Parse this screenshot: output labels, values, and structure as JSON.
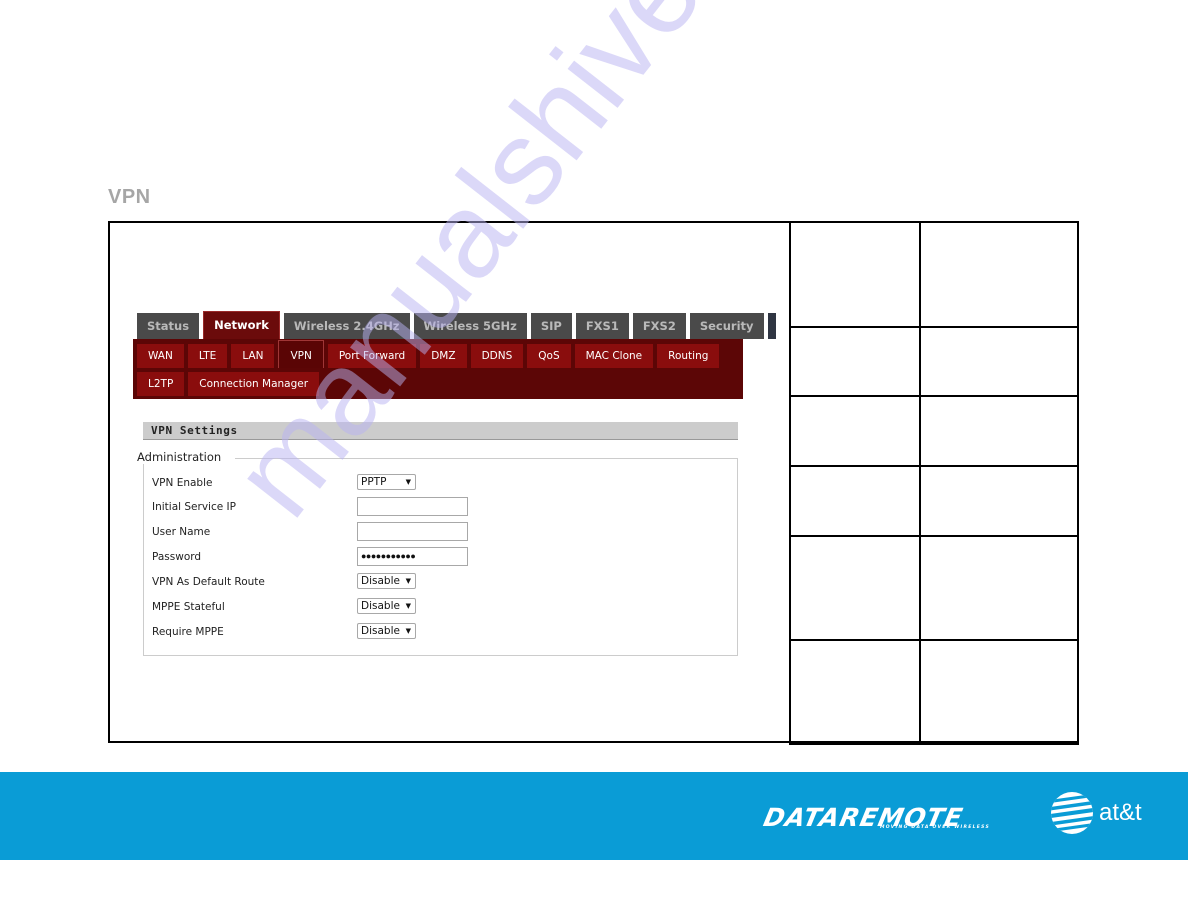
{
  "section_title": "VPN",
  "router_ui": {
    "main_tabs": [
      {
        "label": "Status",
        "active": false
      },
      {
        "label": "Network",
        "active": true
      },
      {
        "label": "Wireless 2.4GHz",
        "active": false
      },
      {
        "label": "Wireless 5GHz",
        "active": false
      },
      {
        "label": "SIP",
        "active": false
      },
      {
        "label": "FXS1",
        "active": false
      },
      {
        "label": "FXS2",
        "active": false
      },
      {
        "label": "Security",
        "active": false
      }
    ],
    "sub_tabs": [
      {
        "label": "WAN",
        "active": false
      },
      {
        "label": "LTE",
        "active": false
      },
      {
        "label": "LAN",
        "active": false
      },
      {
        "label": "VPN",
        "active": true
      },
      {
        "label": "Port Forward",
        "active": false
      },
      {
        "label": "DMZ",
        "active": false
      },
      {
        "label": "DDNS",
        "active": false
      },
      {
        "label": "QoS",
        "active": false
      },
      {
        "label": "MAC Clone",
        "active": false
      },
      {
        "label": "Routing",
        "active": false
      },
      {
        "label": "L2TP",
        "active": false
      },
      {
        "label": "Connection Manager",
        "active": false
      }
    ],
    "panel_title": "VPN Settings",
    "group_legend": "Administration",
    "fields": {
      "vpn_enable": {
        "label": "VPN Enable",
        "value": "PPTP"
      },
      "initial_service_ip": {
        "label": "Initial Service IP",
        "value": ""
      },
      "user_name": {
        "label": "User Name",
        "value": ""
      },
      "password": {
        "label": "Password",
        "value": "●●●●●●●●●●●"
      },
      "vpn_default_route": {
        "label": "VPN As Default Route",
        "value": "Disable"
      },
      "mppe_stateful": {
        "label": "MPPE Stateful",
        "value": "Disable"
      },
      "require_mppe": {
        "label": "Require MPPE",
        "value": "Disable"
      }
    },
    "dropdown_arrow": "▼"
  },
  "right_table": {
    "rows": [
      [
        "",
        ""
      ],
      [
        "",
        ""
      ],
      [
        "",
        ""
      ],
      [
        "",
        ""
      ],
      [
        "",
        ""
      ],
      [
        "",
        ""
      ]
    ]
  },
  "footer": {
    "brand": "DATAREMOTE",
    "tagline": "MOVING DATA OVER WIRELESS",
    "partner": "at&t",
    "background_color": "#0a9cd6"
  },
  "watermark": "manualshive.com"
}
